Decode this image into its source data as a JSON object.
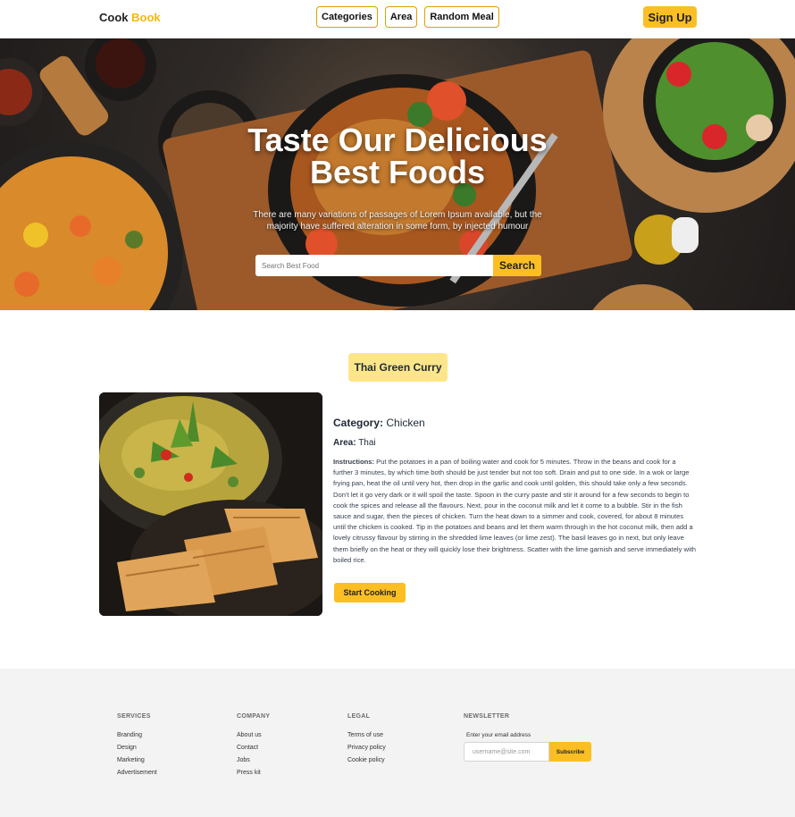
{
  "nav": {
    "logo_first": "Cook",
    "logo_second": "Book",
    "links": [
      "Categories",
      "Area",
      "Random Meal"
    ],
    "signup": "Sign Up"
  },
  "hero": {
    "title": "Taste Our Delicious Best Foods",
    "subtitle": "There are many variations of passages of Lorem Ipsum available, but the majority have suffered alteration in some form, by injected humour",
    "search_placeholder": "Search Best Food",
    "search_button": "Search"
  },
  "meal": {
    "name": "Thai Green Curry",
    "category_label": "Category:",
    "category": "Chicken",
    "area_label": "Area:",
    "area": "Thai",
    "instructions_label": "Instructions:",
    "instructions": "Put the potatoes in a pan of boiling water and cook for 5 minutes. Throw in the beans and cook for a further 3 minutes, by which time both should be just tender but not too soft. Drain and put to one side. In a wok or large frying pan, heat the oil until very hot, then drop in the garlic and cook until golden, this should take only a few seconds. Don’t let it go very dark or it will spoil the taste. Spoon in the curry paste and stir it around for a few seconds to begin to cook the spices and release all the flavours. Next, pour in the coconut milk and let it come to a bubble. Stir in the fish sauce and sugar, then the pieces of chicken. Turn the heat down to a simmer and cook, covered, for about 8 minutes until the chicken is cooked. Tip in the potatoes and beans and let them warm through in the hot coconut milk, then add a lovely citrussy flavour by stirring in the shredded lime leaves (or lime zest). The basil leaves go in next, but only leave them briefly on the heat or they will quickly lose their brightness. Scatter with the lime garnish and serve immediately with boiled rice.",
    "start_button": "Start Cooking"
  },
  "footer": {
    "services": {
      "heading": "SERVICES",
      "links": [
        "Branding",
        "Design",
        "Marketing",
        "Advertisement"
      ]
    },
    "company": {
      "heading": "COMPANY",
      "links": [
        "About us",
        "Contact",
        "Jobs",
        "Press kit"
      ]
    },
    "legal": {
      "heading": "LEGAL",
      "links": [
        "Terms of use",
        "Privacy policy",
        "Cookie policy"
      ]
    },
    "newsletter": {
      "heading": "NEWSLETTER",
      "label": "Enter your email address",
      "placeholder": "username@site.com",
      "button": "Subscribe"
    }
  },
  "colors": {
    "accent": "#fbbf24",
    "meal_title_bg": "#fde68a",
    "footer_bg": "#f3f3f3"
  }
}
